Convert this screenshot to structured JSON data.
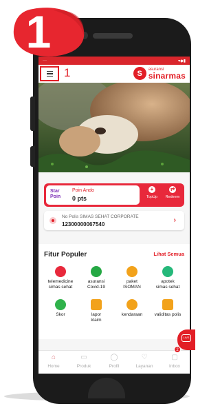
{
  "step": {
    "badge_number": "1",
    "annotation_number": "1"
  },
  "statusbar": {
    "left": "···",
    "right": "▾◆▮"
  },
  "header": {
    "brand_small": "asuransi",
    "brand_big": "sinarmas",
    "brand_logo_letter": "S"
  },
  "poin": {
    "logo_text_1": "Star",
    "logo_text_2": "Poin",
    "label": "Poin Ando",
    "value": "0 pts",
    "topup_label": "TopUp",
    "redeem_label": "Redeem"
  },
  "polis": {
    "label": "No Polis SIMAS SEHAT CORPORATE",
    "number": "12300000067540"
  },
  "fitur": {
    "title": "Fitur Populer",
    "see_all": "Lihat Semua",
    "items": [
      {
        "line1": "telemedicine",
        "line2": "simas sehat",
        "icon": "telemedicine-icon",
        "color": "#e8283b"
      },
      {
        "line1": "asuransi",
        "line2": "Covid-19",
        "icon": "covid-icon",
        "color": "#25a844"
      },
      {
        "line1": "paket",
        "line2": "ISOMAN",
        "icon": "package-icon",
        "color": "#f2a21b"
      },
      {
        "line1": "apotek",
        "line2": "simas sehat",
        "icon": "pharmacy-icon",
        "color": "#25b87a"
      },
      {
        "line1": "Skor",
        "line2": "",
        "icon": "score-icon",
        "color": "#2fb24b"
      },
      {
        "line1": "lapor",
        "line2": "klaim",
        "icon": "claim-icon",
        "color": "#f2a21b"
      },
      {
        "line1": "kendaraan",
        "line2": "",
        "icon": "vehicle-icon",
        "color": "#f2a21b"
      },
      {
        "line1": "validitas polis",
        "line2": "",
        "icon": "validity-icon",
        "color": "#f2a21b"
      }
    ]
  },
  "nav": [
    {
      "label": "Home",
      "icon": "home-icon",
      "glyph": "⌂"
    },
    {
      "label": "Produk",
      "icon": "product-icon",
      "glyph": "▭"
    },
    {
      "label": "Profil",
      "icon": "profile-icon",
      "glyph": "◯"
    },
    {
      "label": "Layanan",
      "icon": "service-icon",
      "glyph": "♡"
    },
    {
      "label": "Inbox",
      "icon": "inbox-icon",
      "glyph": "▢"
    }
  ],
  "live_chat": {
    "label": "LIVE",
    "badge": "2"
  },
  "colors": {
    "accent": "#e21e26",
    "star_poin": "#7b2bb5"
  }
}
